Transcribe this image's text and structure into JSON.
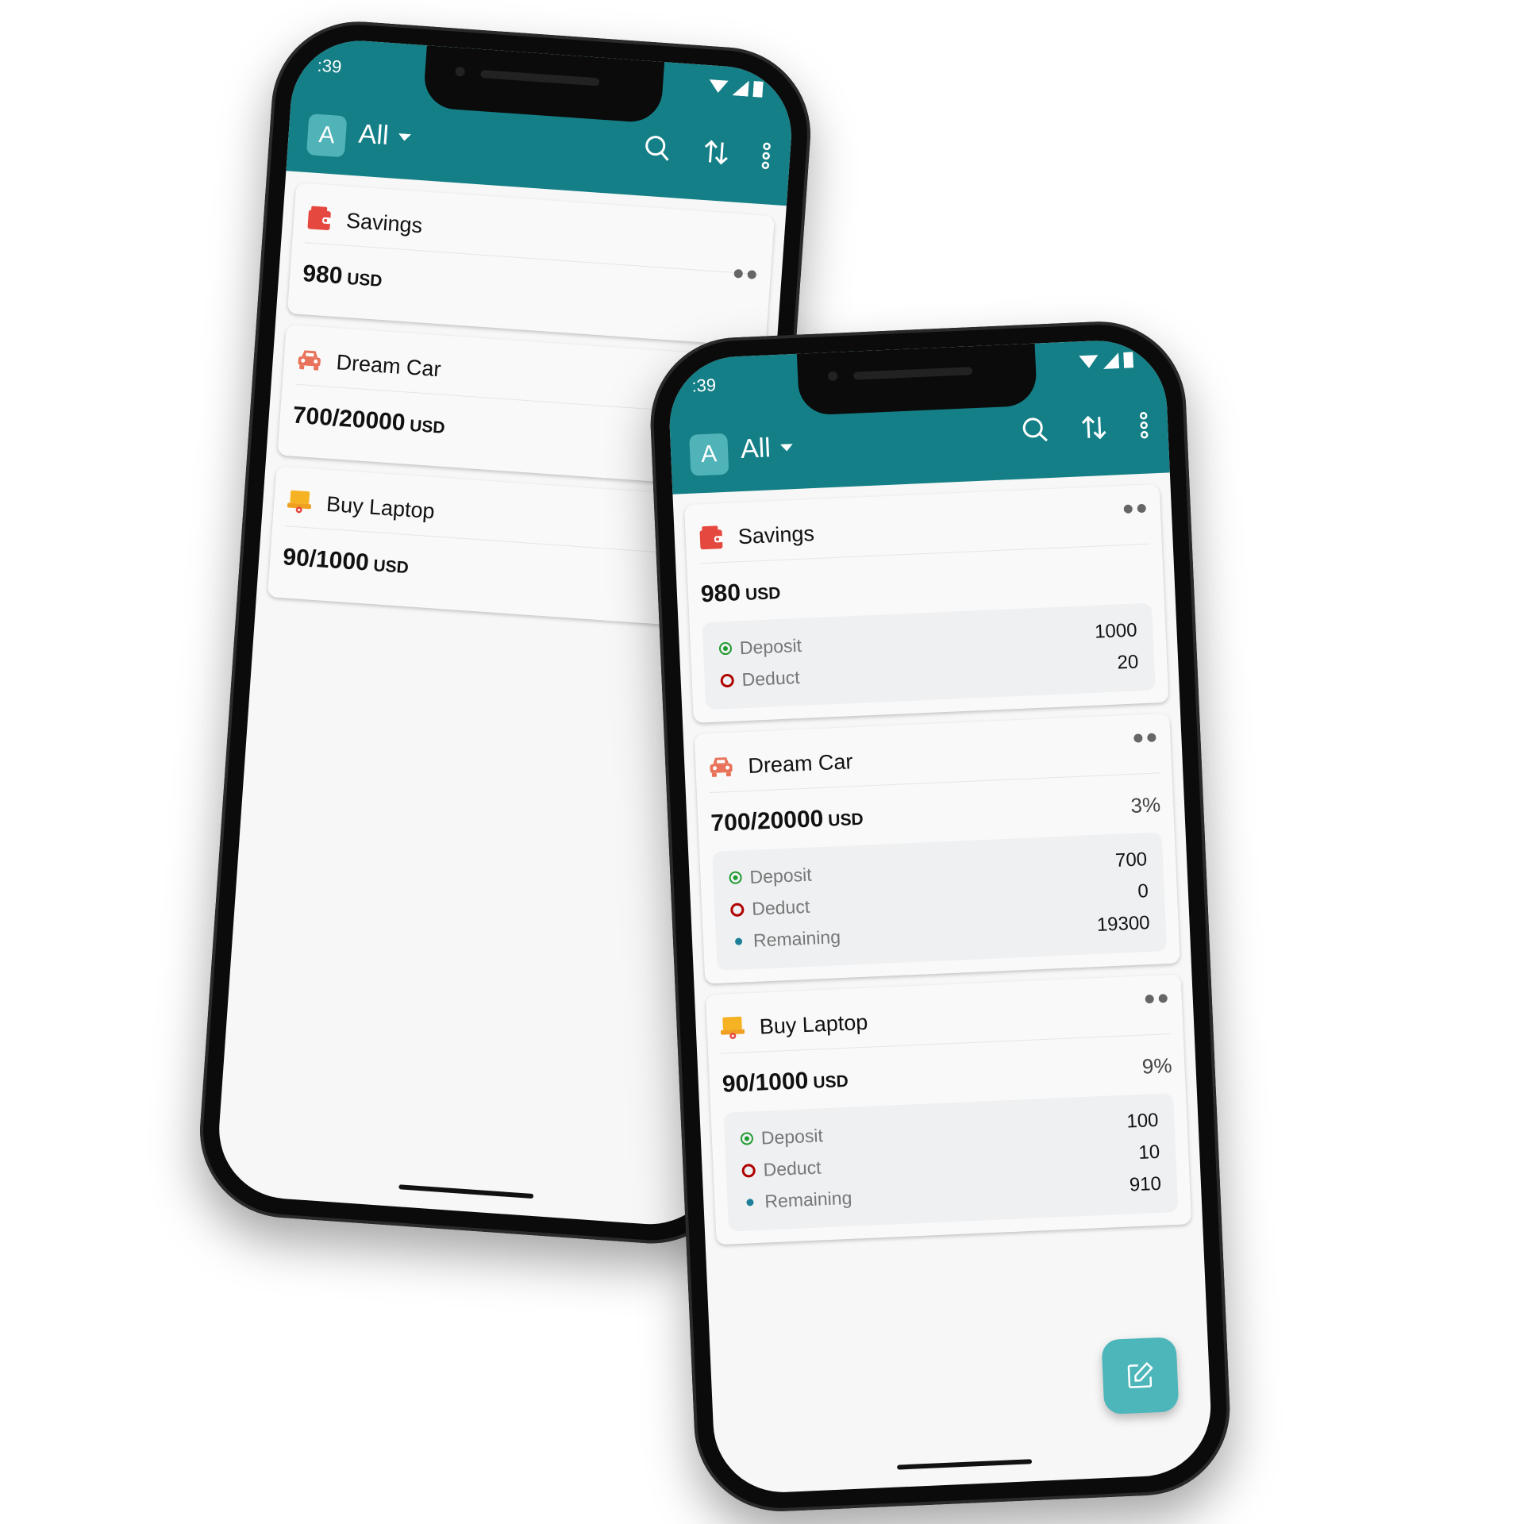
{
  "colors": {
    "appbar": "#147f86",
    "avatar": "#4fb3b8",
    "fab": "#4db6ba",
    "savings_icon": "#e5483f",
    "car_icon": "#e8735a",
    "laptop_icon": "#f5b324",
    "deposit": "#1f9a2e",
    "deduct": "#b00000",
    "remaining": "#1d7f9a"
  },
  "back": {
    "status": {
      "time": ":39"
    },
    "appbar": {
      "avatar_letter": "A",
      "filter_label": "All"
    },
    "cards": [
      {
        "title": "Savings",
        "icon": "wallet-icon",
        "amount": "980",
        "currency": "USD"
      },
      {
        "title": "Dream Car",
        "icon": "car-icon",
        "amount": "700/20000",
        "currency": "USD"
      },
      {
        "title": "Buy Laptop",
        "icon": "laptop-icon",
        "amount": "90/1000",
        "currency": "USD"
      }
    ]
  },
  "front": {
    "status": {
      "time": ":39"
    },
    "appbar": {
      "avatar_letter": "A",
      "filter_label": "All"
    },
    "cards": [
      {
        "title": "Savings",
        "icon": "wallet-icon",
        "amount": "980",
        "currency": "USD",
        "percent": "",
        "details": {
          "deposit_label": "Deposit",
          "deposit": "1000",
          "deduct_label": "Deduct",
          "deduct": "20"
        }
      },
      {
        "title": "Dream Car",
        "icon": "car-icon",
        "amount": "700/20000",
        "currency": "USD",
        "percent": "3%",
        "details": {
          "deposit_label": "Deposit",
          "deposit": "700",
          "deduct_label": "Deduct",
          "deduct": "0",
          "remaining_label": "Remaining",
          "remaining": "19300"
        }
      },
      {
        "title": "Buy Laptop",
        "icon": "laptop-icon",
        "amount": "90/1000",
        "currency": "USD",
        "percent": "9%",
        "details": {
          "deposit_label": "Deposit",
          "deposit": "100",
          "deduct_label": "Deduct",
          "deduct": "10",
          "remaining_label": "Remaining",
          "remaining": "910"
        }
      }
    ],
    "fab_icon": "edit-icon"
  }
}
